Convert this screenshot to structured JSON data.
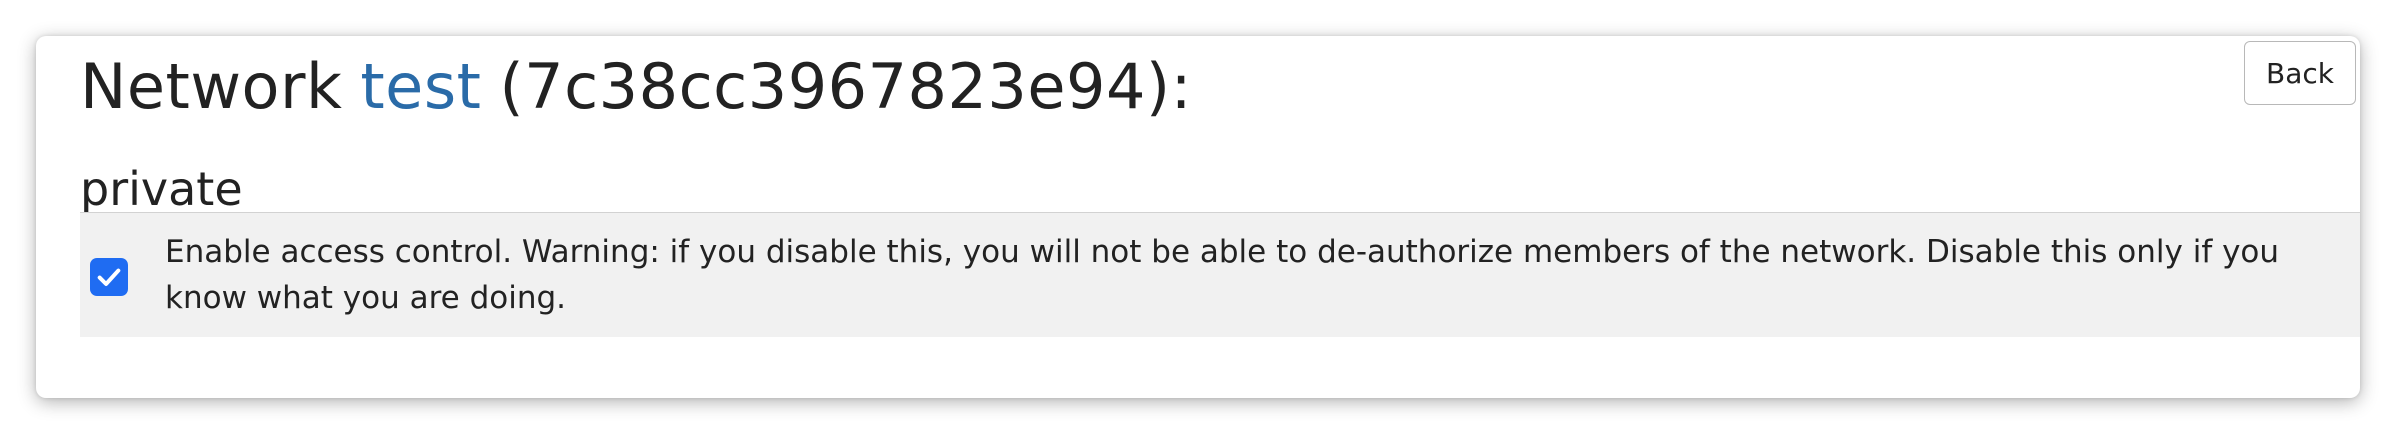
{
  "header": {
    "prefix": "Network",
    "network_name": "test",
    "network_id": "(7c38cc3967823e94):"
  },
  "back_button": {
    "label": "Back"
  },
  "section": {
    "title": "private"
  },
  "access_control": {
    "checked": true,
    "label": "Enable access control. Warning: if you disable this, you will not be able to de-authorize members of the network. Disable this only if you know what you are doing."
  },
  "colors": {
    "link": "#2a6ba8",
    "checkbox": "#1f6cf2",
    "row_background": "#f1f1f1"
  },
  "icons": {
    "checkbox": "checkmark-icon"
  }
}
